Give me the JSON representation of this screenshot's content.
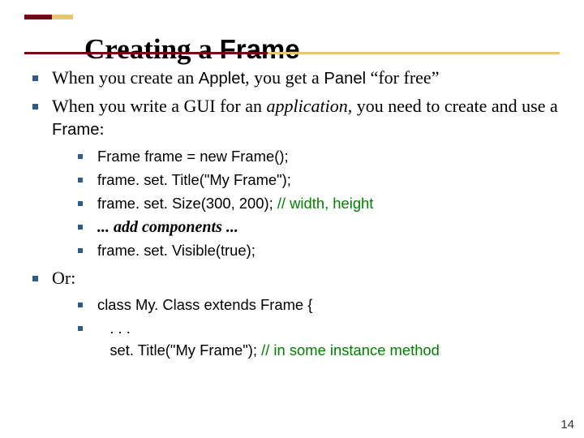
{
  "title": {
    "part1": "Creating a ",
    "part2": "Frame"
  },
  "bullets": {
    "b1": {
      "t1": "When you create an ",
      "applet": "Applet",
      "t2": ", you get a ",
      "panel": "Panel",
      "t3": " “for free”"
    },
    "b2": {
      "t1": "When you write a GUI for an ",
      "app": "application,",
      "t2": " you need to create and use a ",
      "frame_word": "Frame",
      "colon": ":"
    },
    "code": {
      "l1": "Frame frame = new Frame();",
      "l2": "frame. set. Title(\"My Frame\");",
      "l3a": "frame. set. Size(300, 200); ",
      "l3b": "// width, height",
      "l4": "... add components ...",
      "l5": "frame. set. Visible(true);"
    },
    "or": "Or:",
    "code2": {
      "l1": "class My. Class extends Frame {",
      "l2a": "   . . .",
      "l2b": "   set. Title(\"My Frame\"); ",
      "l2c": "// in some instance method"
    }
  },
  "page_number": "14"
}
